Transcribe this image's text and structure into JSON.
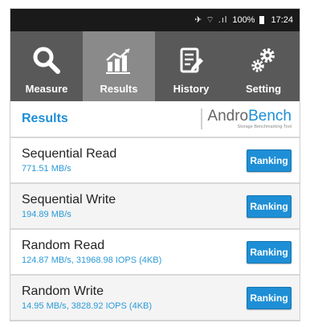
{
  "status_bar": {
    "signal_icons": "✈ ⌔ .ıl",
    "battery": "100%",
    "time": "17:24"
  },
  "tabs": [
    {
      "label": "Measure",
      "icon": "search-icon",
      "active": false
    },
    {
      "label": "Results",
      "icon": "chart-icon",
      "active": true
    },
    {
      "label": "History",
      "icon": "notepad-icon",
      "active": false
    },
    {
      "label": "Setting",
      "icon": "gears-icon",
      "active": false
    }
  ],
  "header": {
    "title": "Results",
    "logo_andro": "Andro",
    "logo_bench": "Bench",
    "logo_tagline": "Storage Benchmarking Tool"
  },
  "results": [
    {
      "name": "Sequential Read",
      "value": "771.51 MB/s",
      "button": "Ranking"
    },
    {
      "name": "Sequential Write",
      "value": "194.89 MB/s",
      "button": "Ranking"
    },
    {
      "name": "Random Read",
      "value": "124.87 MB/s, 31968.98 IOPS (4KB)",
      "button": "Ranking"
    },
    {
      "name": "Random Write",
      "value": "14.95 MB/s, 3828.92 IOPS (4KB)",
      "button": "Ranking"
    }
  ],
  "colors": {
    "accent": "#1e8fd6",
    "tabbar": "#595959",
    "tab_active": "#8a8a8a",
    "statusbar": "#1a1a1a"
  }
}
